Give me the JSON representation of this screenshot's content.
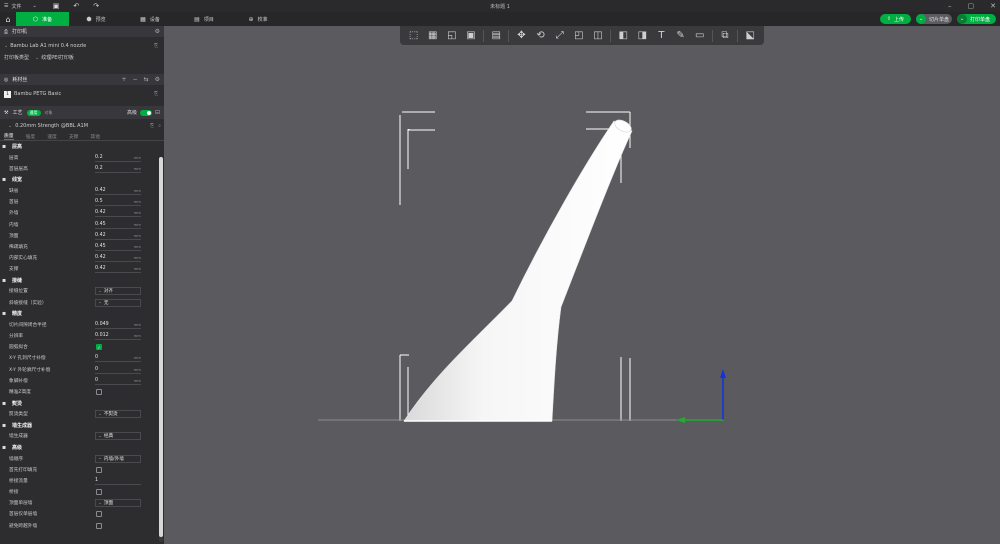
{
  "window": {
    "title": "未标题 1",
    "menu_label": "文件"
  },
  "tabs": [
    {
      "label": "准备",
      "icon": "cube-icon"
    },
    {
      "label": "预览",
      "icon": "preview-icon"
    },
    {
      "label": "设备",
      "icon": "device-icon"
    },
    {
      "label": "项目",
      "icon": "project-icon"
    },
    {
      "label": "校准",
      "icon": "calibrate-icon"
    }
  ],
  "actions": {
    "upload": "上传",
    "slice": "切片单盘",
    "print": "打印单盘"
  },
  "printer": {
    "section": "打印机",
    "name": "Bambu Lab A1 mini 0.4 nozzle",
    "plate_label": "打印板类型",
    "plate_value": "纹理PEI打印板"
  },
  "filament": {
    "section": "耗材丝",
    "index": "1",
    "name": "Bambu PETG Basic"
  },
  "process": {
    "section": "工艺",
    "badge": "通用",
    "badge2": "对象",
    "advanced_label": "高级",
    "preset": "0.20mm Strength @BBL A1M"
  },
  "subtabs": [
    "质量",
    "强度",
    "速度",
    "支撑",
    "其他"
  ],
  "groups": [
    {
      "title": "层高",
      "icon": "layers-icon",
      "params": [
        {
          "label": "层高",
          "value": "0.2",
          "unit": "mm",
          "kind": "num"
        },
        {
          "label": "首层层高",
          "value": "0.2",
          "unit": "mm",
          "kind": "num"
        }
      ]
    },
    {
      "title": "线宽",
      "icon": "linewidth-icon",
      "params": [
        {
          "label": "缺省",
          "value": "0.42",
          "unit": "mm",
          "kind": "num"
        },
        {
          "label": "首层",
          "value": "0.5",
          "unit": "mm",
          "kind": "num"
        },
        {
          "label": "外墙",
          "value": "0.42",
          "unit": "mm",
          "kind": "num"
        },
        {
          "label": "内墙",
          "value": "0.45",
          "unit": "mm",
          "kind": "num"
        },
        {
          "label": "顶面",
          "value": "0.42",
          "unit": "mm",
          "kind": "num"
        },
        {
          "label": "稀疏填充",
          "value": "0.45",
          "unit": "mm",
          "kind": "num"
        },
        {
          "label": "内部实心填充",
          "value": "0.42",
          "unit": "mm",
          "kind": "num"
        },
        {
          "label": "支撑",
          "value": "0.42",
          "unit": "mm",
          "kind": "num"
        }
      ]
    },
    {
      "title": "接缝",
      "icon": "seam-icon",
      "params": [
        {
          "label": "接缝位置",
          "value": "对齐",
          "kind": "sel"
        },
        {
          "label": "斜坡接缝（实验）",
          "value": "无",
          "kind": "sel"
        }
      ]
    },
    {
      "title": "精度",
      "icon": "precision-icon",
      "params": [
        {
          "label": "切片间隙闭合半径",
          "value": "0.049",
          "unit": "mm",
          "kind": "num"
        },
        {
          "label": "分辨率",
          "value": "0.012",
          "unit": "mm",
          "kind": "num"
        },
        {
          "label": "圆弧拟合",
          "value": "",
          "kind": "chk",
          "checked": true
        },
        {
          "label": "X-Y 孔洞尺寸补偿",
          "value": "0",
          "unit": "mm",
          "kind": "num"
        },
        {
          "label": "X-Y 外轮廓尺寸补偿",
          "value": "0",
          "unit": "mm",
          "kind": "num"
        },
        {
          "label": "象脚补偿",
          "value": "0",
          "unit": "mm",
          "kind": "num"
        },
        {
          "label": "精准Z高度",
          "value": "",
          "kind": "chk",
          "checked": false
        }
      ]
    },
    {
      "title": "熨烫",
      "icon": "ironing-icon",
      "params": [
        {
          "label": "熨烫类型",
          "value": "不熨烫",
          "kind": "sel"
        }
      ]
    },
    {
      "title": "墙生成器",
      "icon": "wall-icon",
      "params": [
        {
          "label": "墙生成器",
          "value": "经典",
          "kind": "sel"
        }
      ]
    },
    {
      "title": "高级",
      "icon": "advanced-icon",
      "params": [
        {
          "label": "墙顺序",
          "value": "内墙/外墙",
          "kind": "sel"
        },
        {
          "label": "首先打印填充",
          "value": "",
          "kind": "chk",
          "checked": false
        },
        {
          "label": "桥接流量",
          "value": "1",
          "kind": "num",
          "unit": ""
        },
        {
          "label": "桥接",
          "value": "",
          "kind": "chk",
          "checked": false
        },
        {
          "label": "顶面单层墙",
          "value": "顶面",
          "kind": "sel"
        },
        {
          "label": "首层仅单层墙",
          "value": "",
          "kind": "chk",
          "checked": false
        },
        {
          "label": "避免跨越外墙",
          "value": "",
          "kind": "chk",
          "checked": false
        }
      ]
    }
  ],
  "colors": {
    "accent": "#00ae42",
    "viewport": "#5b5b5f",
    "panel": "#2d2d30"
  }
}
